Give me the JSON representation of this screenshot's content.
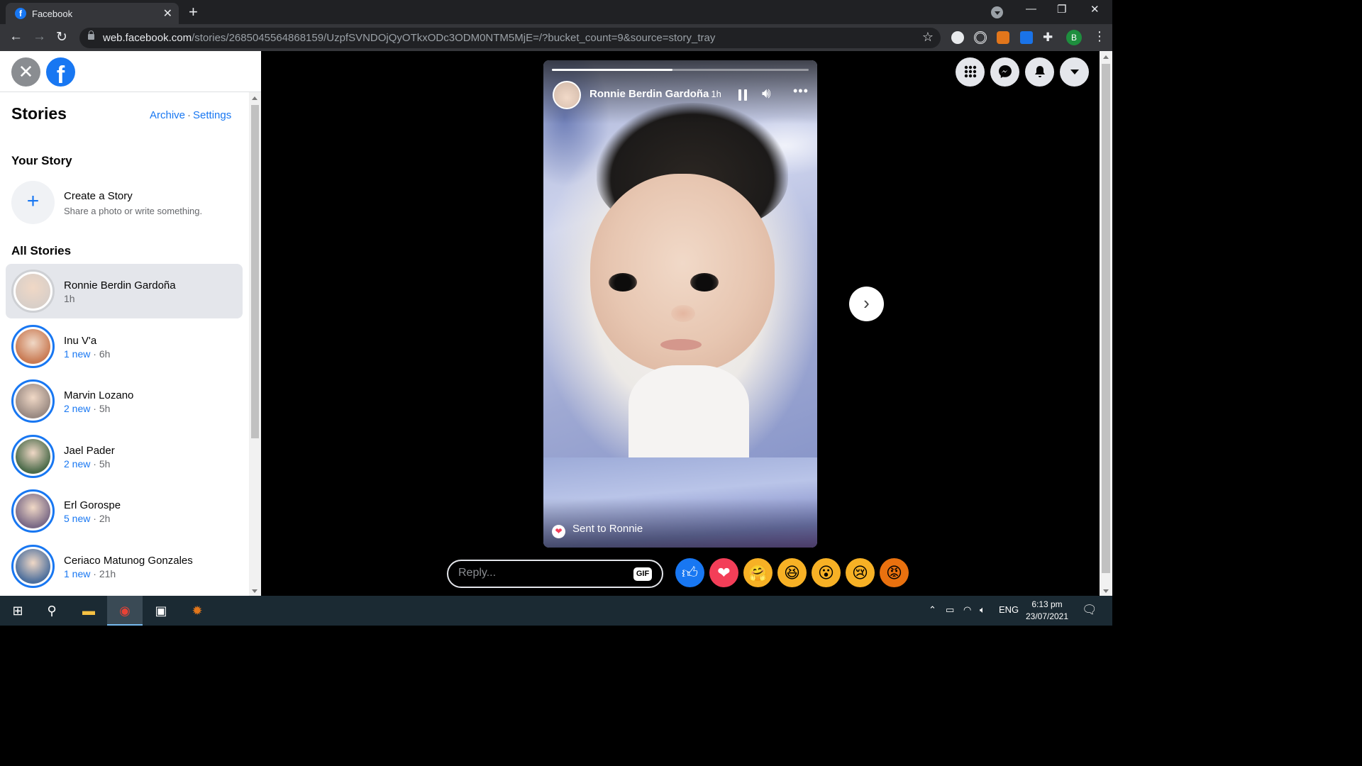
{
  "browser": {
    "tab_title": "Facebook",
    "url_host": "web.facebook.com",
    "url_path": "/stories/2685045564868159/UzpfSVNDOjQyOTkxODc3ODM0NTM5MjE=/?bucket_count=9&source=story_tray",
    "profile_initial": "B"
  },
  "sidebar": {
    "title": "Stories",
    "archive_label": "Archive",
    "links_separator": "·",
    "settings_label": "Settings",
    "your_story_heading": "Your Story",
    "create_story": {
      "title": "Create a Story",
      "subtitle": "Share a photo or write something."
    },
    "all_stories_heading": "All Stories",
    "stories": [
      {
        "name": "Ronnie Berdin Gardoña",
        "new_label": "",
        "time": "1h",
        "active": true,
        "avatar_color": "#d9cfc8"
      },
      {
        "name": "Inu V'a",
        "new_label": "1 new",
        "time": "6h",
        "active": false,
        "avatar_color": "#c97b54"
      },
      {
        "name": "Marvin Lozano",
        "new_label": "2 new",
        "time": "5h",
        "active": false,
        "avatar_color": "#9a8a82"
      },
      {
        "name": "Jael Pader",
        "new_label": "2 new",
        "time": "5h",
        "active": false,
        "avatar_color": "#4c6b4a"
      },
      {
        "name": "Erl Gorospe",
        "new_label": "5 new",
        "time": "2h",
        "active": false,
        "avatar_color": "#7b6a86"
      },
      {
        "name": "Ceriaco Matunog Gonzales",
        "new_label": "1 new",
        "time": "21h",
        "active": false,
        "avatar_color": "#4d6f9c"
      }
    ]
  },
  "viewer": {
    "poster_name": "Ronnie Berdin Gardoña",
    "poster_time": "1h",
    "progress": 0.47,
    "sent_text": "Sent to Ronnie",
    "reply_placeholder": "Reply...",
    "gif_label": "GIF",
    "reactions": [
      "like",
      "love",
      "care",
      "haha",
      "wow",
      "sad",
      "angry"
    ]
  },
  "taskbar": {
    "language": "ENG",
    "time": "6:13 pm",
    "date": "23/07/2021"
  },
  "colors": {
    "fb_blue": "#1877f2",
    "active_story_bg": "#e4e6eb"
  }
}
